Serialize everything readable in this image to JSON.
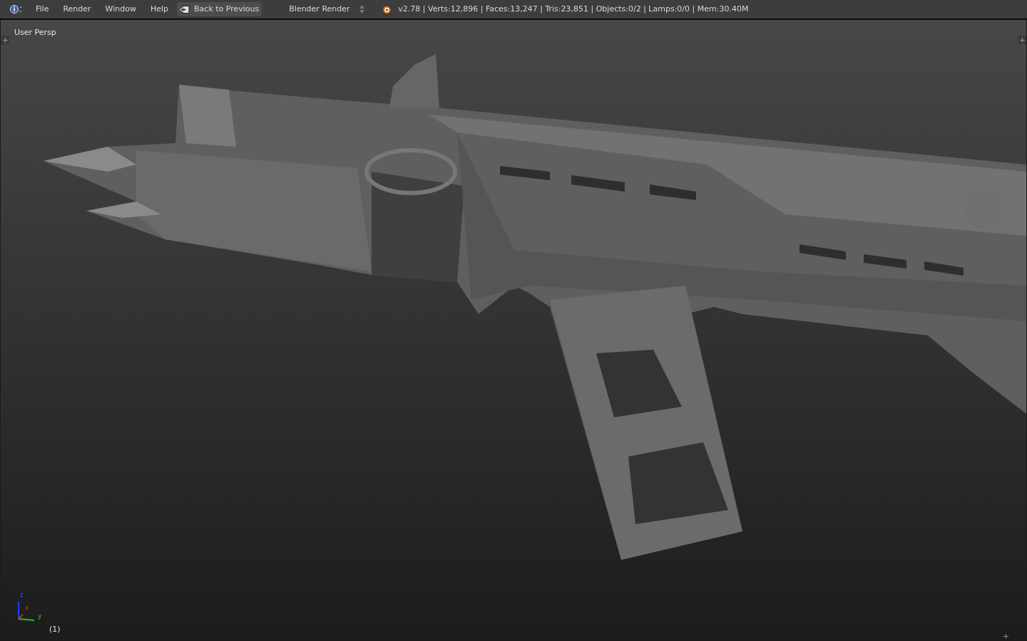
{
  "header": {
    "menus": [
      "File",
      "Render",
      "Window",
      "Help"
    ],
    "back_button": "Back to Previous",
    "render_engine": "Blender Render",
    "stats": "v2.78 | Verts:12,896 | Faces:13,247 | Tris:23,851 | Objects:0/2 | Lamps:0/0 | Mem:30.40M"
  },
  "viewport": {
    "view_name": "User Persp",
    "axes": {
      "x": "x",
      "y": "y",
      "z": "z"
    },
    "frame": "(1)"
  }
}
